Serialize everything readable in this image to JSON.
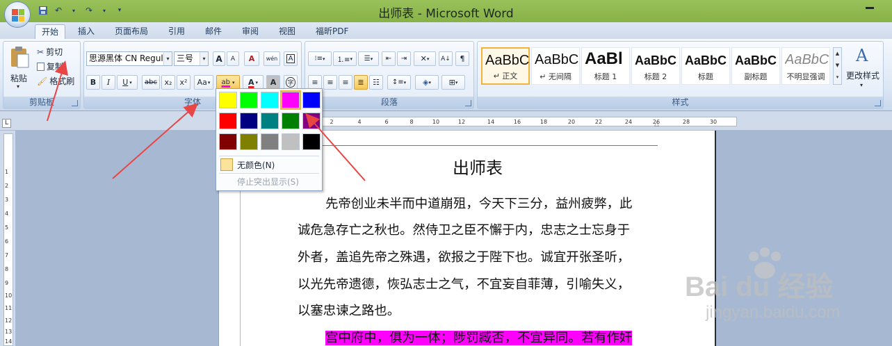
{
  "window": {
    "title": "出师表 - Microsoft Word"
  },
  "tabs": [
    "开始",
    "插入",
    "页面布局",
    "引用",
    "邮件",
    "审阅",
    "视图",
    "福昕PDF"
  ],
  "clipboard": {
    "paste": "粘贴",
    "cut": "剪切",
    "copy": "复制",
    "format_painter": "格式刷",
    "group": "剪贴板"
  },
  "font": {
    "name": "思源黑体 CN Regul",
    "size": "三号",
    "group": "字体",
    "buttons": {
      "bold": "B",
      "italic": "I",
      "underline": "U",
      "strike": "abc",
      "sub": "x₂",
      "sup": "x²",
      "case": "Aa",
      "grow": "A",
      "shrink": "A",
      "clear": "A",
      "phonetic": "wén",
      "border": "A",
      "shade": "A",
      "enclose": "字",
      "highlight": "ab",
      "font_color": "A"
    }
  },
  "paragraph": {
    "group": "段落"
  },
  "styles": {
    "group": "样式",
    "items": [
      {
        "sample": "AaBbCcDd",
        "name": "↵ 正文"
      },
      {
        "sample": "AaBbCcDd",
        "name": "↵ 无间隔"
      },
      {
        "sample": "AaBl",
        "name": "标题 1"
      },
      {
        "sample": "AaBbC",
        "name": "标题 2"
      },
      {
        "sample": "AaBbC",
        "name": "标题"
      },
      {
        "sample": "AaBbC",
        "name": "副标题"
      },
      {
        "sample": "AaBbCcD",
        "name": "不明显强调"
      }
    ],
    "change_styles": "更改样式"
  },
  "highlight_menu": {
    "colors": [
      "#ffff00",
      "#00ff00",
      "#00ffff",
      "#ff00ff",
      "#0000ff",
      "#ff0000",
      "#000080",
      "#008080",
      "#008000",
      "#800080",
      "#800000",
      "#808000",
      "#808080",
      "#c0c0c0",
      "#000000"
    ],
    "selected_color": "#ff00ff",
    "no_color": "无颜色(N)",
    "stop_highlight": "停止突出显示(S)"
  },
  "ruler": {
    "marks": [
      "2",
      "4",
      "6",
      "8",
      "10",
      "12",
      "14",
      "16",
      "18",
      "20",
      "22",
      "24",
      "26",
      "28",
      "30"
    ],
    "vmarks": [
      "1",
      "2",
      "3",
      "4",
      "5",
      "6",
      "7",
      "8",
      "9",
      "10",
      "11",
      "12",
      "13",
      "14"
    ]
  },
  "document": {
    "title": "出师表",
    "lines": [
      "先帝创业未半而中道崩殂，今天下三分，益州疲弊，此",
      "诚危急存亡之秋也。然侍卫之臣不懈于内，忠志之士忘身于",
      "外者，盖追先帝之殊遇，欲报之于陛下也。诚宜开张圣听，",
      "以光先帝遗德，恢弘志士之气，不宜妄自菲薄，引喻失义，",
      "以塞忠谏之路也。"
    ],
    "highlighted_line": "宫中府中，俱为一体；陟罚臧否，不宜异同。若有作奸"
  },
  "watermark": {
    "brand": "Bai du 经验",
    "url": "jingyan.baidu.com"
  },
  "colors": {
    "titlebar": "#8fbb4f",
    "highlight": "#ff00ff",
    "arrow": "#e84545"
  }
}
